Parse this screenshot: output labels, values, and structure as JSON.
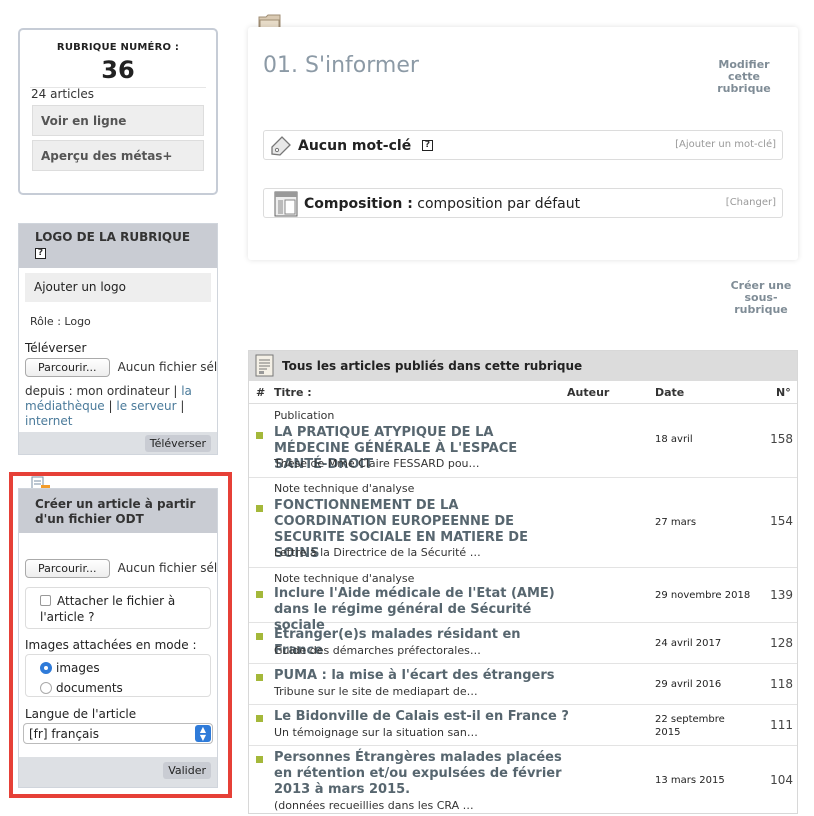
{
  "rubrique_box": {
    "label": "RUBRIQUE NUMÉRO :",
    "number": "36",
    "count": "24 articles",
    "btn_online": "Voir en ligne",
    "btn_meta": "Aperçu des métas+"
  },
  "logo_box": {
    "title": "LOGO DE LA RUBRIQUE",
    "help": "?",
    "add_logo": "Ajouter un logo",
    "role": "Rôle : Logo",
    "upload_label": "Téléverser",
    "browse": "Parcourir...",
    "no_file": "Aucun fichier sélectionné.",
    "from_prefix": "depuis : mon ordinateur |",
    "from_link1": "la médiathèque",
    "sep": "|",
    "from_link2": "le serveur",
    "from_link3": "internet",
    "submit": "Téléverser"
  },
  "odt_box": {
    "title": "Créer un article à partir d'un fichier ODT",
    "browse": "Parcourir...",
    "no_file": "Aucun fichier sélectionné.",
    "attach": "Attacher le fichier à l'article ?",
    "images_mode": "Images attachées en mode :",
    "opt_images": "images",
    "opt_documents": "documents",
    "lang_label": "Langue de l'article",
    "lang_value": "[fr] français",
    "submit": "Valider"
  },
  "main": {
    "title": "01. S'informer",
    "modify": "Modifier cette rubrique",
    "keywords_label": "Aucun mot-clé",
    "keywords_help": "?",
    "keywords_action": "[Ajouter un mot-clé]",
    "composition_label": "Composition :",
    "composition_value": "composition par défaut",
    "composition_action": "[Changer]",
    "create_sub": "Créer une sous-rubrique"
  },
  "articles": {
    "header": "Tous les articles publiés dans cette rubrique",
    "col_hash": "#",
    "col_title": "Titre :",
    "col_author": "Auteur",
    "col_date": "Date",
    "col_num": "N°",
    "items": [
      {
        "super": "Publication",
        "title": "LA PRATIQUE ATYPIQUE DE LA MÉDECINE GÉNÉRALE À L'ESPACE SANTÉ-DROIT",
        "desc": "Thèse de Mme Claire FESSARD pou…",
        "date": "18 avril",
        "num": "158"
      },
      {
        "super": "Note technique d'analyse",
        "title": "FONCTIONNEMENT DE LA COORDINATION EUROPEENNE DE SECURITE SOCIALE EN MATIERE DE SOINS",
        "desc": "Lettre à la Directrice de la Sécurité …",
        "date": "27 mars",
        "num": "154"
      },
      {
        "super": "Note technique d'analyse",
        "title": "Inclure l'Aide médicale de l'Etat (AME) dans le régime général de Sécurité sociale",
        "desc": "",
        "date": "29 novembre 2018",
        "num": "139"
      },
      {
        "super": "",
        "title": "Étranger(e)s malades résidant en France",
        "desc": "Guide des démarches préfectorales…",
        "date": "24 avril 2017",
        "num": "128"
      },
      {
        "super": "",
        "title": "PUMA : la mise à l'écart des étrangers",
        "desc": "Tribune sur le site de mediapart de…",
        "date": "29 avril 2016",
        "num": "118"
      },
      {
        "super": "",
        "title": "Le Bidonville de Calais est-il en France ?",
        "desc": "Un témoignage sur la situation san…",
        "date": "22 septembre 2015",
        "num": "111"
      },
      {
        "super": "",
        "title": "Personnes Étrangères malades placées en rétention et/ou expulsées de février 2013 à mars 2015.",
        "desc": "(données recueillies dans les CRA …",
        "date": "13 mars 2015",
        "num": "104"
      }
    ]
  },
  "colors": {
    "accent": "#a4b83a",
    "highlight": "#e64037",
    "select": "#2f7bd9"
  }
}
